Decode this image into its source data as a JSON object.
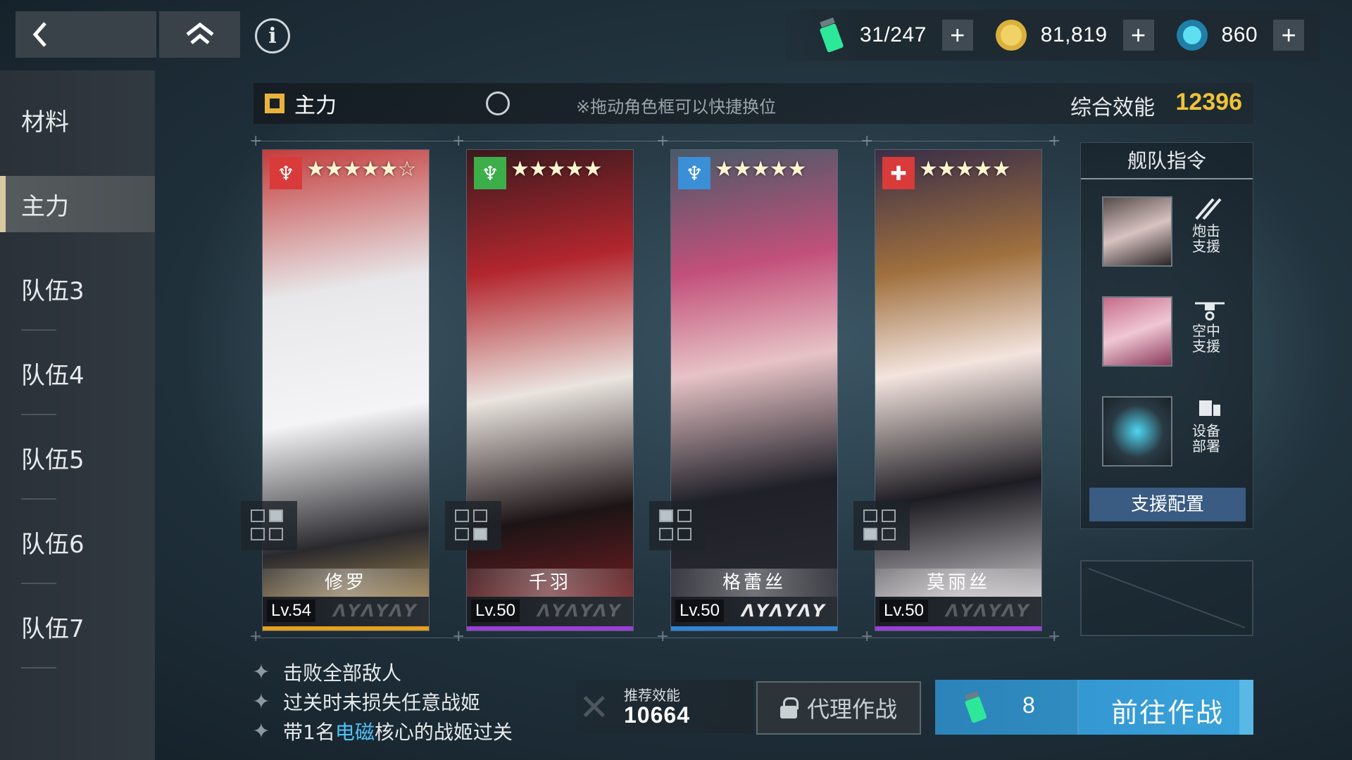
{
  "resources": {
    "stamina": "31/247",
    "gold": "81,819",
    "crystal": "860"
  },
  "sidebar": {
    "items": [
      {
        "label": "材料"
      },
      {
        "label": "主力"
      },
      {
        "label": "队伍3"
      },
      {
        "label": "队伍4"
      },
      {
        "label": "队伍5"
      },
      {
        "label": "队伍6"
      },
      {
        "label": "队伍7"
      }
    ],
    "active_index": 1
  },
  "team": {
    "name": "主力",
    "hint": "※拖动角色框可以快捷换位",
    "power_label": "综合效能",
    "power_value": "12396"
  },
  "characters": [
    {
      "name": "修罗",
      "level": "Lv.54",
      "stars": "★★★★★☆",
      "element_color": "#d93a3a",
      "rank_color": "#e4a020"
    },
    {
      "name": "千羽",
      "level": "Lv.50",
      "stars": "★★★★★",
      "element_color": "#3cae4a",
      "rank_color": "#9b3fd6"
    },
    {
      "name": "格蕾丝",
      "level": "Lv.50",
      "stars": "★★★★★",
      "element_color": "#3a8fd6",
      "rank_color": "#2f84d8"
    },
    {
      "name": "莫丽丝",
      "level": "Lv.50",
      "stars": "★★★★★",
      "element_color": "#d93a3a",
      "rank_color": "#9b3fd6"
    }
  ],
  "fleet": {
    "title": "舰队指令",
    "rows": [
      {
        "label": "炮击支援",
        "icon": "bombard-icon"
      },
      {
        "label": "空中支援",
        "icon": "drone-icon"
      },
      {
        "label": "设备部署",
        "icon": "device-icon"
      }
    ],
    "support_button": "支援配置"
  },
  "objectives": {
    "line1": "击败全部敌人",
    "line2": "过关时未损失任意战姬",
    "line3_pre": "带1名",
    "line3_hl": "电磁",
    "line3_post": "核心的战姬过关"
  },
  "recommend": {
    "label": "推荐效能",
    "value": "10664"
  },
  "buttons": {
    "proxy": "代理作战",
    "go": "前往作战",
    "go_cost": "8"
  },
  "colors": {
    "accent_gold": "#f0c23a",
    "go_blue": "#3aa3dc",
    "highlight_blue": "#4fc3f7"
  }
}
